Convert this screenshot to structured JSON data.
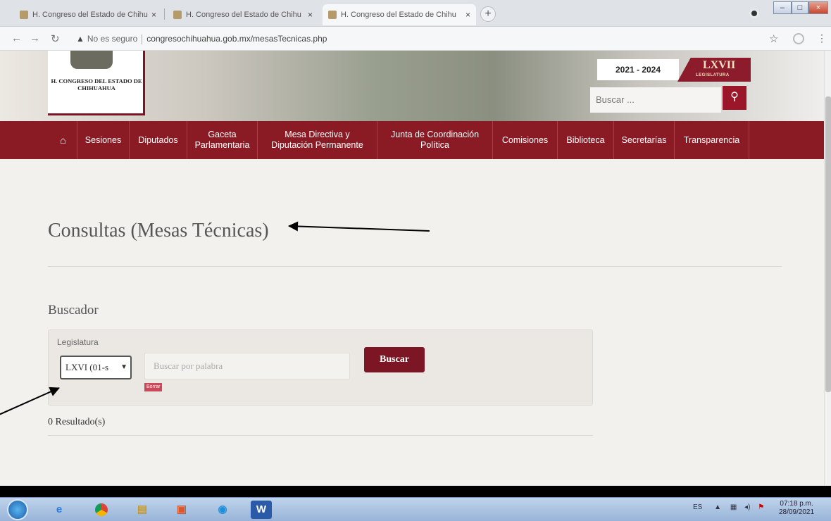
{
  "browser": {
    "tabs": [
      {
        "title": "H. Congreso del Estado de Chihu"
      },
      {
        "title": "H. Congreso del Estado de Chihu"
      },
      {
        "title": "H. Congreso del Estado de Chihu"
      }
    ],
    "tab_close": "×",
    "new_tab": "+",
    "window_controls": {
      "minimize": "–",
      "maximize": "□",
      "close": "×"
    },
    "security_label": "No es seguro",
    "url": "congresochihuahua.gob.mx/mesasTecnicas.php"
  },
  "site": {
    "logo_text": "H. CONGRESO DEL ESTADO DE CHIHUAHUA",
    "period": "2021 - 2024",
    "legislature_num": "LXVII",
    "legislature_label": "LEGISLATURA",
    "search_placeholder": "Buscar ...",
    "nav": [
      {
        "label": "Sesiones"
      },
      {
        "label": "Diputados"
      },
      {
        "label": "Gaceta\nParlamentaria"
      },
      {
        "label": "Mesa Directiva y\nDiputación Permanente"
      },
      {
        "label": "Junta de Coordinación\nPolítica"
      },
      {
        "label": "Comisiones"
      },
      {
        "label": "Biblioteca"
      },
      {
        "label": "Secretarías"
      },
      {
        "label": "Transparencia"
      }
    ]
  },
  "main": {
    "title": "Consultas (Mesas Técnicas)",
    "search_section_title": "Buscador",
    "legislatura_label": "Legislatura",
    "legislatura_selected": "LXVI (01-s",
    "word_placeholder": "Buscar por palabra",
    "clear_label": "Borrar",
    "search_button": "Buscar",
    "results_text": "0 Resultado(s)"
  },
  "taskbar": {
    "language": "ES",
    "time": "07:18 p.m.",
    "date": "28/09/2021"
  },
  "colors": {
    "brand": "#8a1b24",
    "button": "#7d1624"
  }
}
